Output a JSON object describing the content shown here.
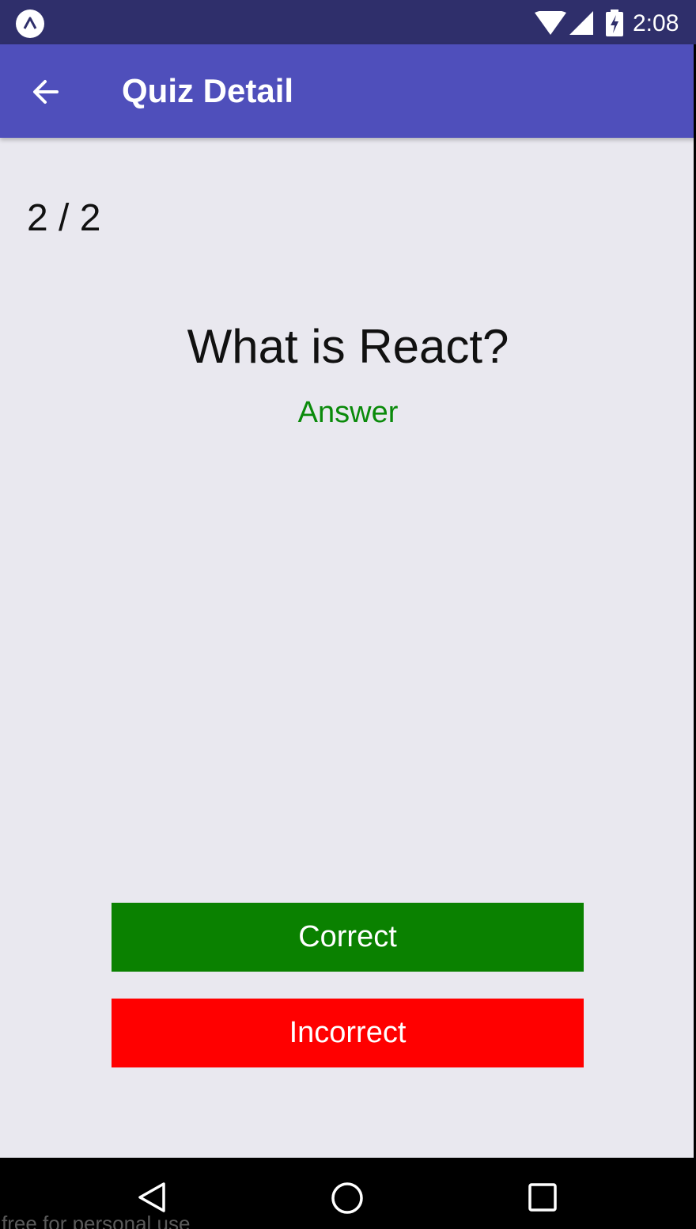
{
  "status_bar": {
    "time": "2:08",
    "icons": [
      "expo-icon",
      "wifi-icon",
      "cell-signal-icon",
      "battery-charging-icon"
    ]
  },
  "app_bar": {
    "title": "Quiz Detail",
    "back_icon": "arrow-left-icon"
  },
  "quiz": {
    "progress": "2 / 2",
    "question": "What is React?",
    "answer_toggle": "Answer",
    "correct_label": "Correct",
    "incorrect_label": "Incorrect"
  },
  "nav_bar": {
    "icons": [
      "nav-back-icon",
      "nav-home-icon",
      "nav-recents-icon"
    ]
  },
  "watermark": "free for personal use",
  "colors": {
    "status_bar": "#2f2f6b",
    "app_bar": "#4f4fbb",
    "background": "#e9e8ef",
    "answer": "#0a8a0a",
    "correct": "#0a8100",
    "incorrect": "#ff0000"
  }
}
